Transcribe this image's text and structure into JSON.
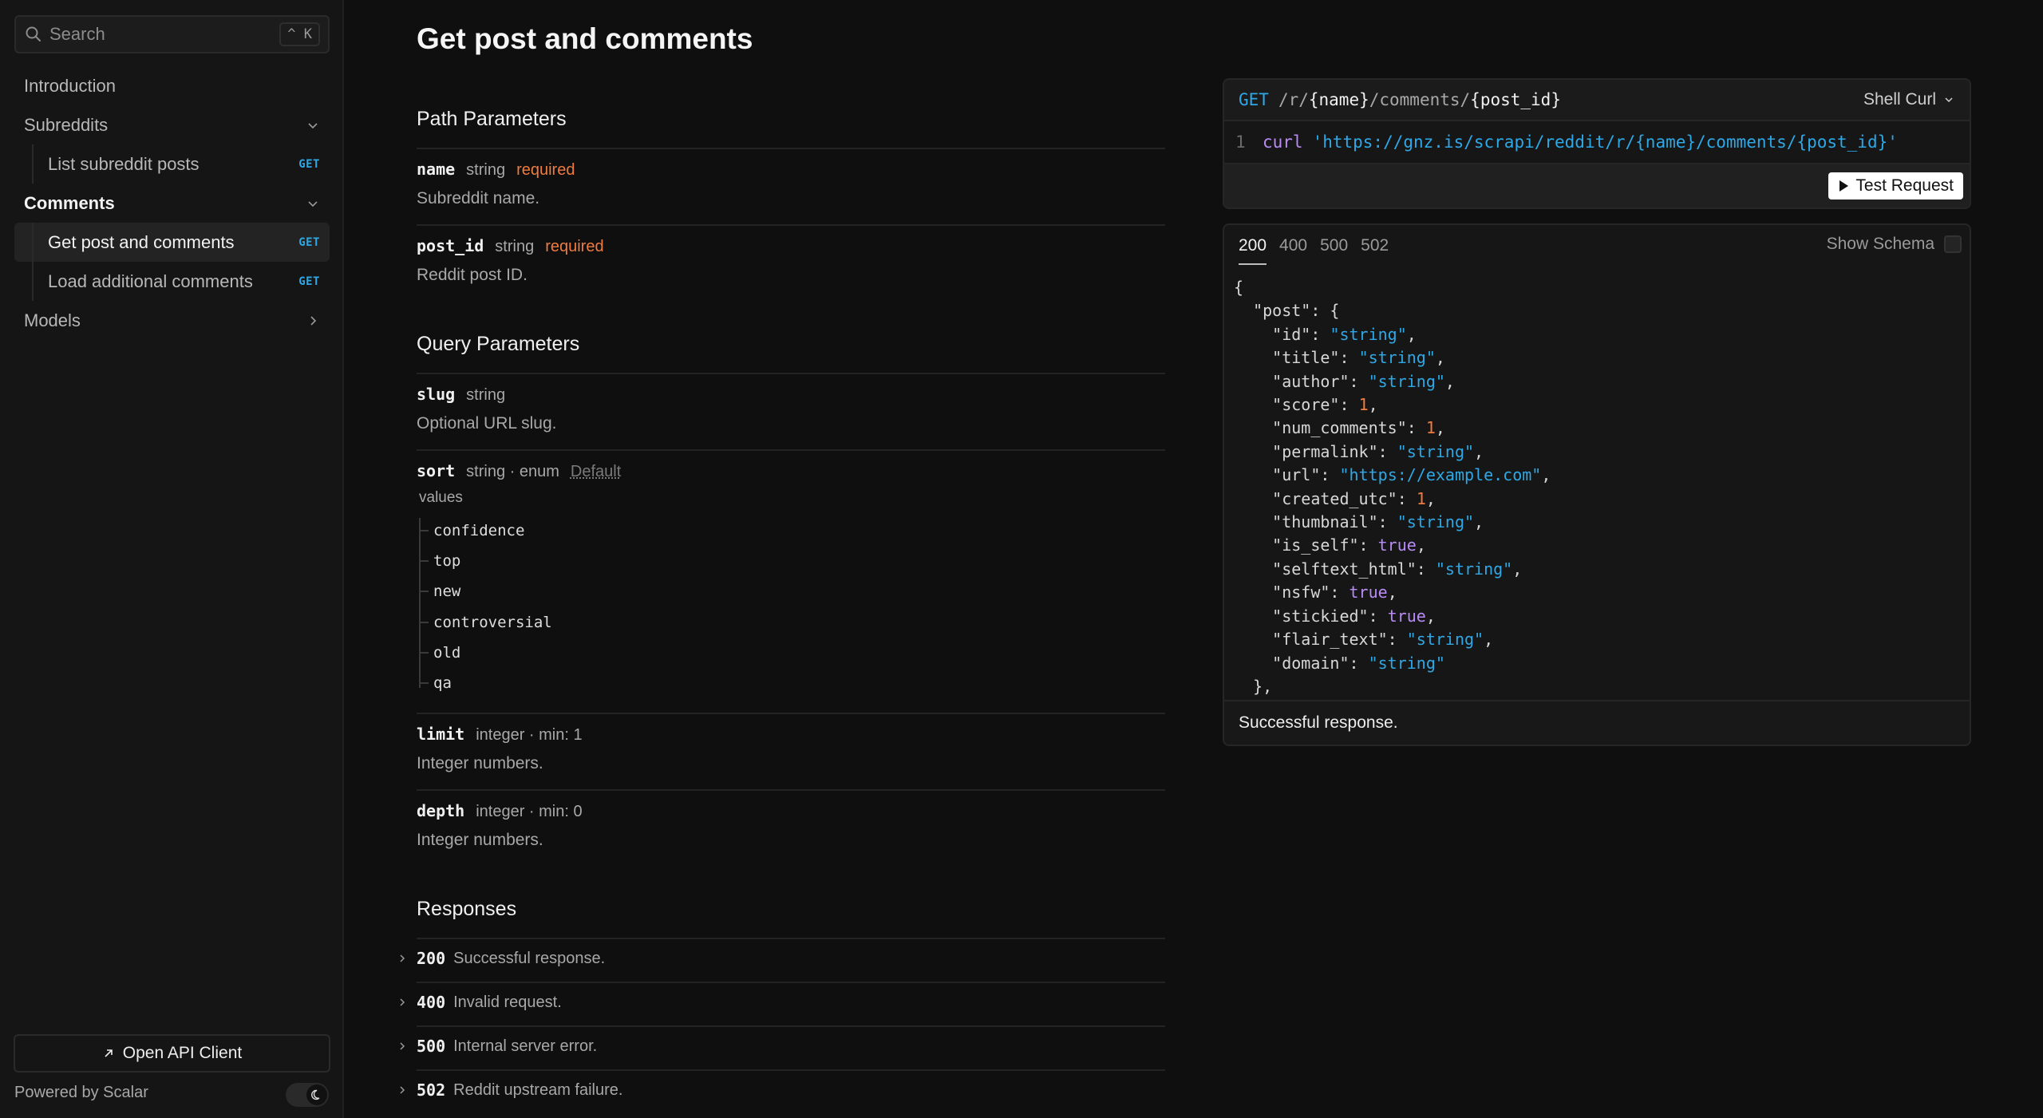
{
  "sidebar": {
    "search_placeholder": "Search",
    "search_shortcut": "^ K",
    "items": [
      {
        "label": "Introduction"
      },
      {
        "label": "Subreddits"
      },
      {
        "label": "List subreddit posts",
        "method": "GET"
      },
      {
        "label": "Comments"
      },
      {
        "label": "Get post and comments",
        "method": "GET"
      },
      {
        "label": "Load additional comments",
        "method": "GET"
      },
      {
        "label": "Models"
      }
    ],
    "open_client": "Open API Client",
    "powered_by": "Powered by Scalar"
  },
  "main": {
    "title": "Get post and comments",
    "path_params_title": "Path Parameters",
    "path_params": [
      {
        "name": "name",
        "type": "string",
        "required": "required",
        "desc": "Subreddit name."
      },
      {
        "name": "post_id",
        "type": "string",
        "required": "required",
        "desc": "Reddit post ID."
      }
    ],
    "query_params_title": "Query Parameters",
    "query_params": [
      {
        "name": "slug",
        "type": "string",
        "desc": "Optional URL slug."
      },
      {
        "name": "sort",
        "type": "string · enum",
        "default": "Default",
        "values_label": "values",
        "values": [
          "confidence",
          "top",
          "new",
          "controversial",
          "old",
          "qa"
        ]
      },
      {
        "name": "limit",
        "type": "integer · min:  1",
        "desc": "Integer numbers."
      },
      {
        "name": "depth",
        "type": "integer · min:  0",
        "desc": "Integer numbers."
      }
    ],
    "responses_title": "Responses",
    "responses": [
      {
        "code": "200",
        "desc": "Successful response."
      },
      {
        "code": "400",
        "desc": "Invalid request."
      },
      {
        "code": "500",
        "desc": "Internal server error."
      },
      {
        "code": "502",
        "desc": "Reddit upstream failure."
      }
    ]
  },
  "request": {
    "method": "GET",
    "path_parts": [
      "/r/",
      "{name}",
      "/comments/",
      "{post_id}"
    ],
    "language": "Shell Curl",
    "line_number": "1",
    "command": "curl",
    "url": "'https://gnz.is/scrapi/reddit/r/{name}/comments/{post_id}'",
    "test_button": "Test Request"
  },
  "response": {
    "tabs": [
      "200",
      "400",
      "500",
      "502"
    ],
    "show_schema": "Show Schema",
    "footer": "Successful response.",
    "json": {
      "open": "{",
      "post_key": "\"post\"",
      "fields": [
        {
          "key": "\"id\"",
          "value": "\"string\"",
          "kind": "str"
        },
        {
          "key": "\"title\"",
          "value": "\"string\"",
          "kind": "str"
        },
        {
          "key": "\"author\"",
          "value": "\"string\"",
          "kind": "str"
        },
        {
          "key": "\"score\"",
          "value": "1",
          "kind": "num"
        },
        {
          "key": "\"num_comments\"",
          "value": "1",
          "kind": "num"
        },
        {
          "key": "\"permalink\"",
          "value": "\"string\"",
          "kind": "str"
        },
        {
          "key": "\"url\"",
          "value": "\"https://example.com\"",
          "kind": "str"
        },
        {
          "key": "\"created_utc\"",
          "value": "1",
          "kind": "num"
        },
        {
          "key": "\"thumbnail\"",
          "value": "\"string\"",
          "kind": "str"
        },
        {
          "key": "\"is_self\"",
          "value": "true",
          "kind": "bool"
        },
        {
          "key": "\"selftext_html\"",
          "value": "\"string\"",
          "kind": "str"
        },
        {
          "key": "\"nsfw\"",
          "value": "true",
          "kind": "bool"
        },
        {
          "key": "\"stickied\"",
          "value": "true",
          "kind": "bool"
        },
        {
          "key": "\"flair_text\"",
          "value": "\"string\"",
          "kind": "str"
        },
        {
          "key": "\"domain\"",
          "value": "\"string\"",
          "kind": "str"
        }
      ],
      "close_post": "},"
    }
  }
}
